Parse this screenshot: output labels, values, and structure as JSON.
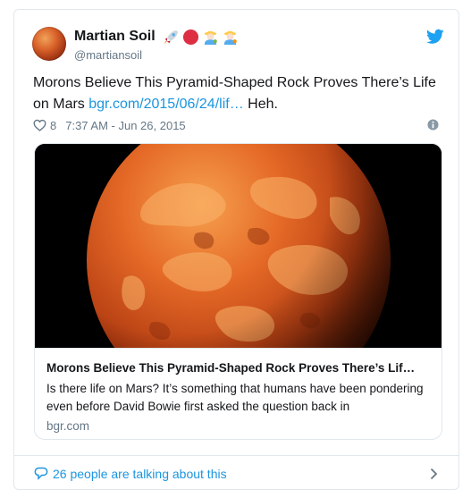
{
  "tweet": {
    "display_name": "Martian Soil",
    "handle": "@martiansoil",
    "emojis": [
      "rocket-emoji",
      "red-circle-emoji",
      "farmer-emoji",
      "farmer-emoji"
    ],
    "text_prefix": "Morons Believe This Pyramid-Shaped Rock Proves There’s Life on Mars ",
    "link_text": "bgr.com/2015/06/24/lif…",
    "text_suffix": " Heh.",
    "like_count": "8",
    "timestamp": "7:37 AM - Jun 26, 2015"
  },
  "card": {
    "title": "Morons Believe This Pyramid-Shaped Rock Proves There’s Lif…",
    "description": "Is there life on Mars? It’s something that humans have been pondering even before David Bowie first asked the question back in",
    "domain": "bgr.com"
  },
  "footer": {
    "conversation_text": "26 people are talking about this"
  },
  "colors": {
    "link_blue": "#1b95e0",
    "twitter_blue": "#1da1f2",
    "secondary_text": "#657786",
    "border": "#e1e8ed",
    "mars_orange": "#d9531e"
  }
}
